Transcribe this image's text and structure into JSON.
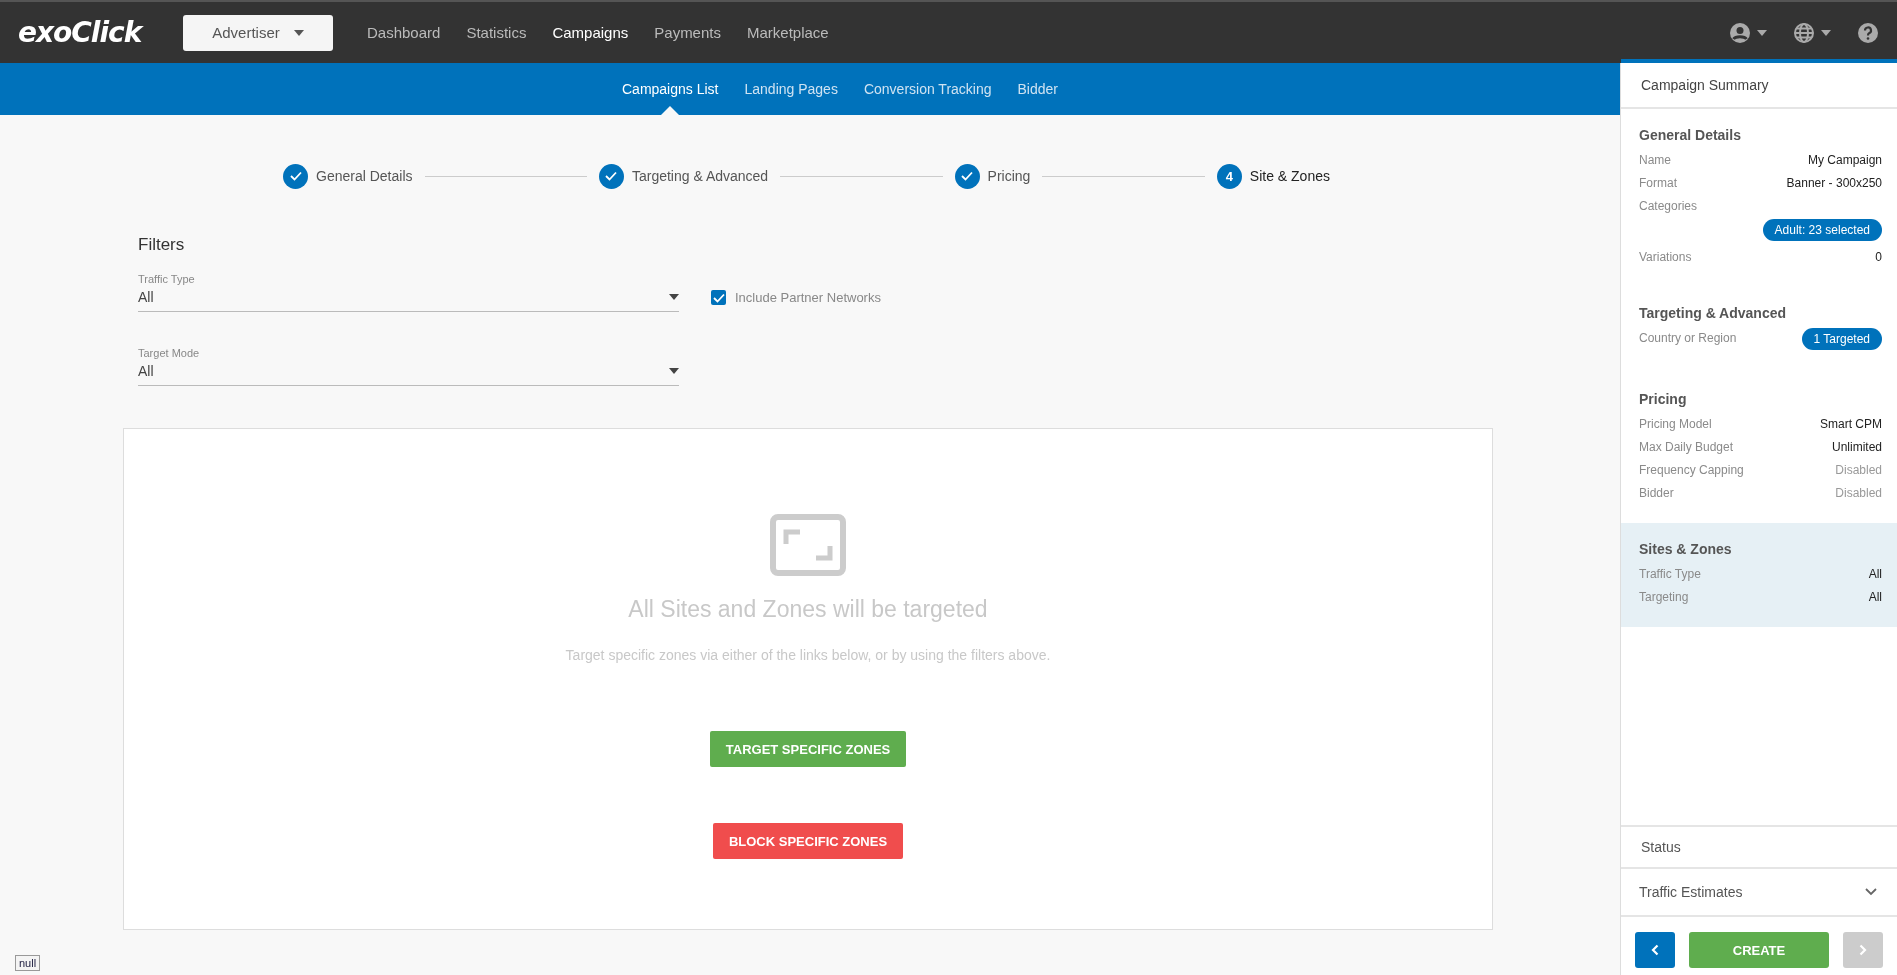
{
  "logo": "exoClick",
  "account_menu": {
    "label": "Advertiser"
  },
  "nav": [
    {
      "label": "Dashboard",
      "selected": false
    },
    {
      "label": "Statistics",
      "selected": false
    },
    {
      "label": "Campaigns",
      "selected": true
    },
    {
      "label": "Payments",
      "selected": false
    },
    {
      "label": "Marketplace",
      "selected": false
    }
  ],
  "subnav": [
    {
      "label": "Campaigns List",
      "selected": true
    },
    {
      "label": "Landing Pages",
      "selected": false
    },
    {
      "label": "Conversion Tracking",
      "selected": false
    },
    {
      "label": "Bidder",
      "selected": false
    }
  ],
  "steps": [
    {
      "label": "General Details",
      "done": true
    },
    {
      "label": "Targeting & Advanced",
      "done": true
    },
    {
      "label": "Pricing",
      "done": true
    },
    {
      "label": "Site & Zones",
      "done": false,
      "number": "4"
    }
  ],
  "filters": {
    "title": "Filters",
    "traffic_type": {
      "label": "Traffic Type",
      "value": "All"
    },
    "partner_networks": {
      "label": "Include Partner Networks",
      "checked": true
    },
    "target_mode": {
      "label": "Target Mode",
      "value": "All"
    }
  },
  "targeting_card": {
    "heading": "All Sites and Zones will be targeted",
    "description": "Target specific zones via either of the links below, or by using the filters above.",
    "buttons": [
      {
        "label": "TARGET SPECIFIC ZONES",
        "kind": "target"
      },
      {
        "label": "BLOCK SPECIFIC ZONES",
        "kind": "block"
      }
    ]
  },
  "summary": {
    "title": "Campaign Summary",
    "sections": [
      {
        "title": "General Details",
        "highlighted": false,
        "rows": [
          {
            "label": "Name",
            "value": "My Campaign",
            "kind": "text"
          },
          {
            "label": "Format",
            "value": "Banner - 300x250",
            "kind": "text"
          },
          {
            "label": "Categories",
            "value": "Adult: 23 selected",
            "kind": "tag-below"
          },
          {
            "label": "Variations",
            "value": "0",
            "kind": "text"
          }
        ]
      },
      {
        "title": "Targeting & Advanced",
        "highlighted": false,
        "rows": [
          {
            "label": "Country or Region",
            "value": "1 Targeted",
            "kind": "tag"
          }
        ]
      },
      {
        "title": "Pricing",
        "highlighted": false,
        "rows": [
          {
            "label": "Pricing Model",
            "value": "Smart CPM",
            "kind": "text"
          },
          {
            "label": "Max Daily Budget",
            "value": "Unlimited",
            "kind": "text"
          },
          {
            "label": "Frequency Capping",
            "value": "Disabled",
            "kind": "muted"
          },
          {
            "label": "Bidder",
            "value": "Disabled",
            "kind": "muted"
          }
        ]
      },
      {
        "title": "Sites & Zones",
        "highlighted": true,
        "rows": [
          {
            "label": "Traffic Type",
            "value": "All",
            "kind": "text"
          },
          {
            "label": "Targeting",
            "value": "All",
            "kind": "text"
          }
        ]
      }
    ]
  },
  "status": {
    "title": "Status"
  },
  "traffic_estimates": {
    "title": "Traffic Estimates",
    "expanded": false
  },
  "footer": {
    "create": "CREATE",
    "back_disabled": false,
    "next_disabled": true
  },
  "debug_label": "null"
}
